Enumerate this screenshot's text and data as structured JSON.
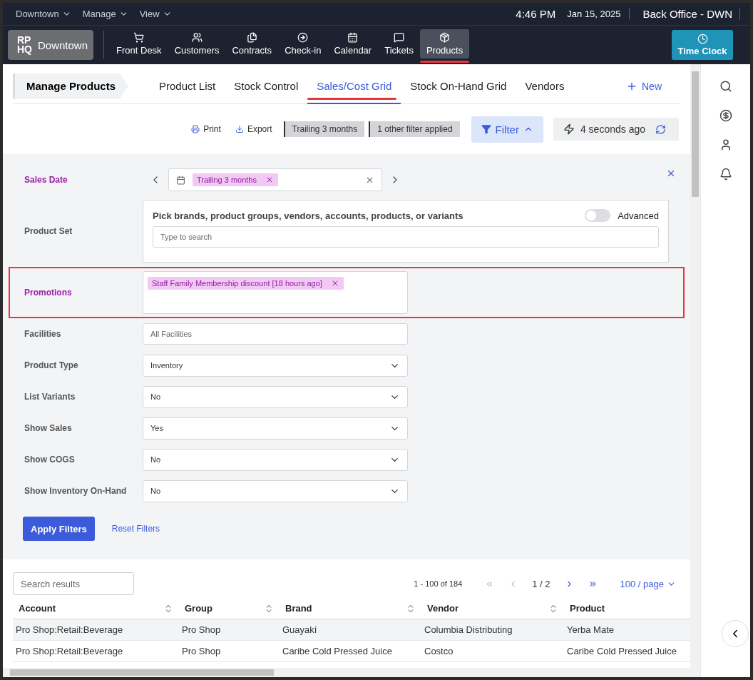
{
  "top_bar": {
    "menus": [
      "Downtown",
      "Manage",
      "View"
    ],
    "time": "4:46 PM",
    "date": "Jan 15, 2025",
    "location": "Back Office - DWN"
  },
  "nav": {
    "logo_lines": [
      "RP",
      "HQ"
    ],
    "location": "Downtown",
    "time_clock": "Time Clock",
    "items": [
      {
        "label": "Front Desk",
        "selected": false,
        "annotated": false
      },
      {
        "label": "Customers",
        "selected": false,
        "annotated": false
      },
      {
        "label": "Contracts",
        "selected": false,
        "annotated": false
      },
      {
        "label": "Check-in",
        "selected": false,
        "annotated": false
      },
      {
        "label": "Calendar",
        "selected": false,
        "annotated": false
      },
      {
        "label": "Tickets",
        "selected": false,
        "annotated": false
      },
      {
        "label": "Products",
        "selected": true,
        "annotated": true
      }
    ]
  },
  "tabs": {
    "title": "Manage Products",
    "new_button": "New",
    "items": [
      {
        "label": "Product List",
        "selected": false,
        "annotated": false
      },
      {
        "label": "Stock Control",
        "selected": false,
        "annotated": false
      },
      {
        "label": "Sales/Cost Grid",
        "selected": true,
        "annotated": true
      },
      {
        "label": "Stock On-Hand Grid",
        "selected": false,
        "annotated": false
      },
      {
        "label": "Vendors",
        "selected": false,
        "annotated": false
      }
    ]
  },
  "toolbar": {
    "print": "Print",
    "export": "Export",
    "chips": [
      "Trailing 3 months",
      "1 other filter applied"
    ],
    "filter": {
      "label": "Filter",
      "expanded": true
    },
    "refreshed": "4 seconds ago"
  },
  "filters": [
    {
      "kind": "date",
      "label": "Sales Date",
      "active": true,
      "highlighted": false,
      "tag": "Trailing 3 months"
    },
    {
      "kind": "product_set",
      "label": "Product Set",
      "active": false,
      "highlighted": false,
      "prompt": "Pick brands, product groups, vendors, accounts, products, or variants",
      "toggle": {
        "label": "Advanced",
        "on": false
      },
      "placeholder": "Type to search"
    },
    {
      "kind": "tags",
      "label": "Promotions",
      "active": true,
      "highlighted": true,
      "tag": "Staff Family Membership discount [18 hours ago]"
    },
    {
      "kind": "text",
      "label": "Facilities",
      "active": false,
      "highlighted": false,
      "placeholder": "All Facilities"
    },
    {
      "kind": "select",
      "label": "Product Type",
      "active": false,
      "highlighted": false,
      "value": "Inventory"
    },
    {
      "kind": "select",
      "label": "List Variants",
      "active": false,
      "highlighted": false,
      "value": "No"
    },
    {
      "kind": "select",
      "label": "Show Sales",
      "active": false,
      "highlighted": false,
      "value": "Yes"
    },
    {
      "kind": "select",
      "label": "Show COGS",
      "active": false,
      "highlighted": false,
      "value": "No"
    },
    {
      "kind": "select",
      "label": "Show Inventory On-Hand",
      "active": false,
      "highlighted": false,
      "value": "No"
    }
  ],
  "filter_actions": {
    "apply": "Apply Filters",
    "reset": "Reset Filters"
  },
  "results": {
    "search_placeholder": "Search results",
    "range": "1 - 100 of 184",
    "page": "1 / 2",
    "page_size": "100 / page",
    "columns": [
      "Account",
      "Group",
      "Brand",
      "Vendor",
      "Product"
    ],
    "rows": [
      [
        "Pro Shop:Retail:Beverage",
        "Pro Shop",
        "Guayakí",
        "Columbia Distributing",
        "Yerba Mate"
      ],
      [
        "Pro Shop:Retail:Beverage",
        "Pro Shop",
        "Caribe Cold Pressed Juice",
        "Costco",
        "Caribe Cold Pressed Juice"
      ]
    ]
  }
}
